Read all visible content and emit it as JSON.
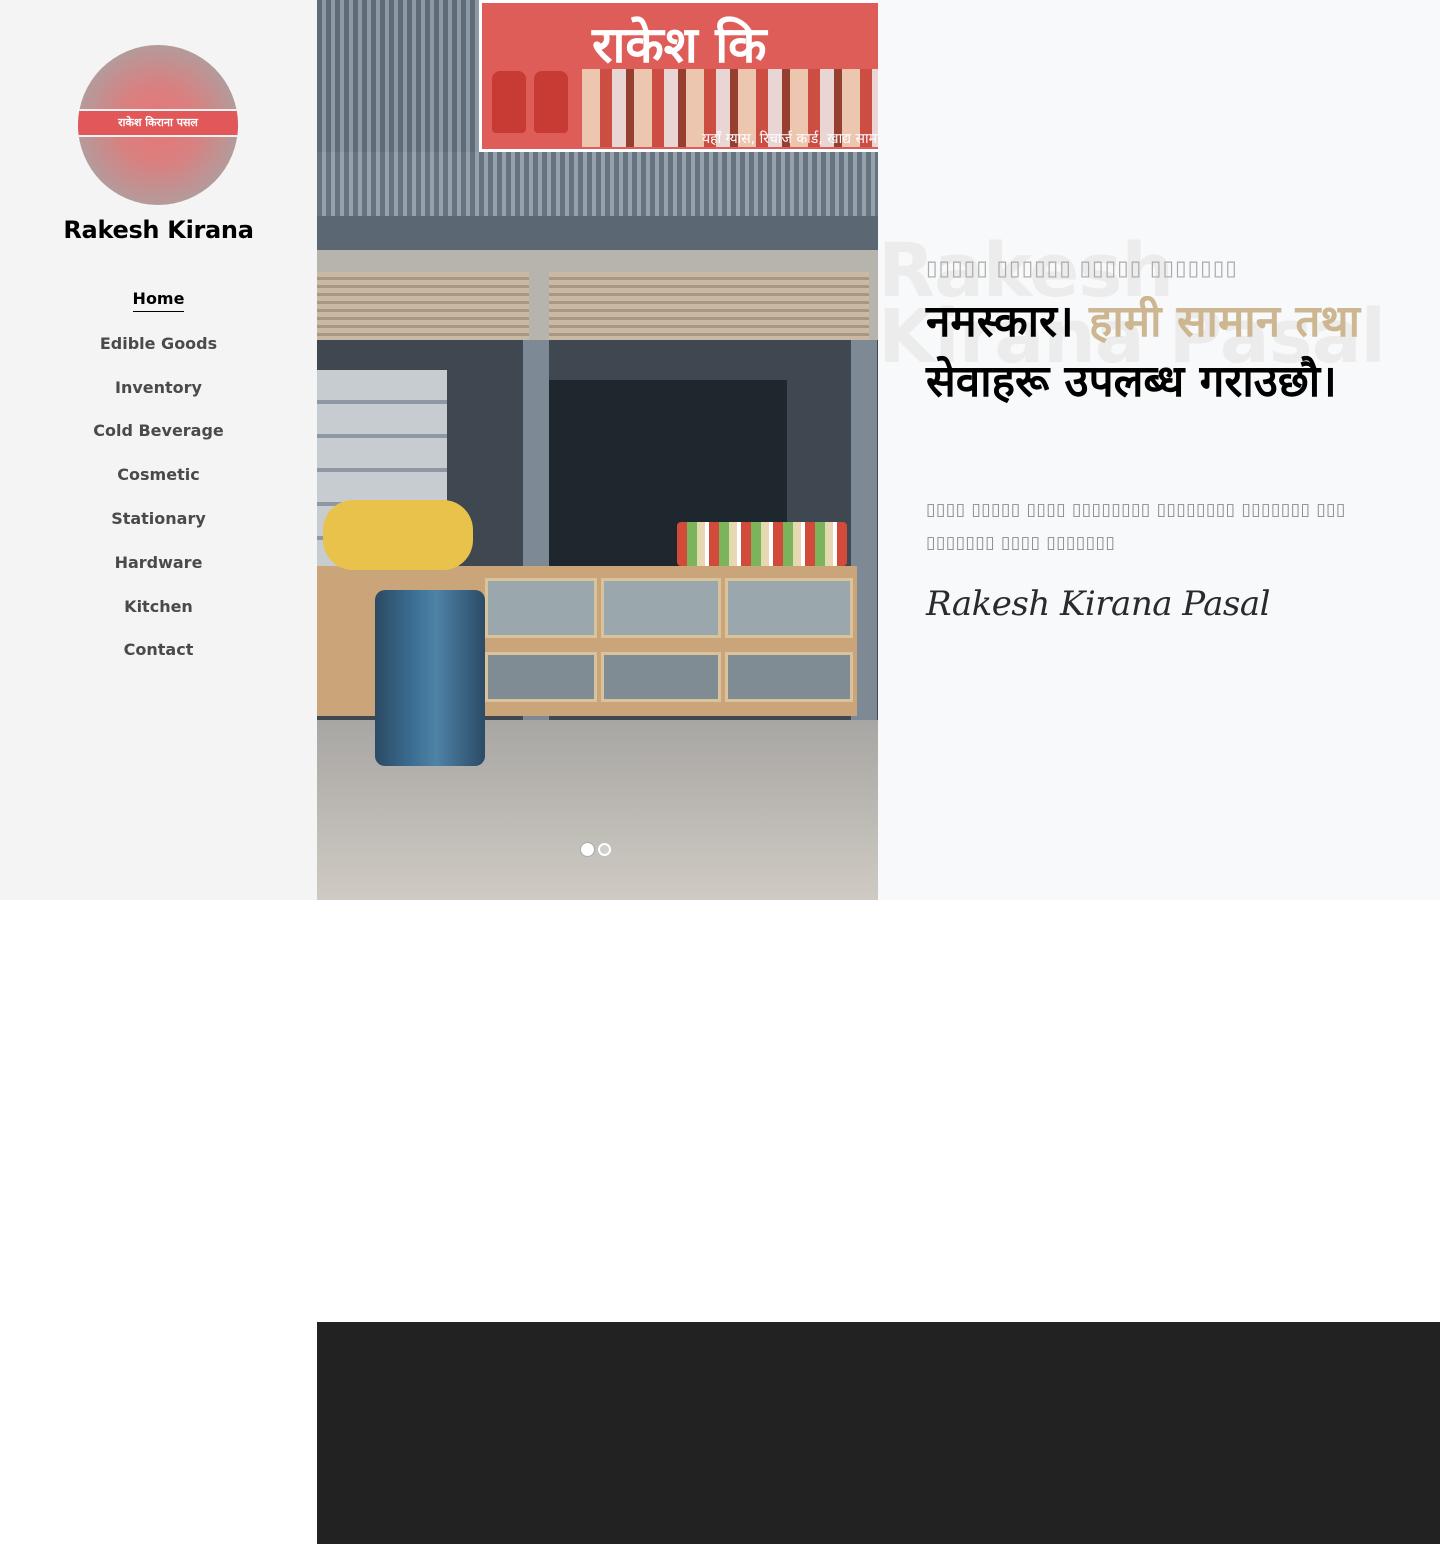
{
  "sidebar": {
    "logo_text": "राकेश किराना पसल",
    "brand": "Rakesh Kirana",
    "nav": [
      {
        "label": "Home",
        "active": true
      },
      {
        "label": "Edible Goods",
        "active": false
      },
      {
        "label": "Inventory",
        "active": false
      },
      {
        "label": "Cold Beverage",
        "active": false
      },
      {
        "label": "Cosmetic",
        "active": false
      },
      {
        "label": "Stationary",
        "active": false
      },
      {
        "label": "Hardware",
        "active": false
      },
      {
        "label": "Kitchen",
        "active": false
      },
      {
        "label": "Contact",
        "active": false
      }
    ]
  },
  "hero": {
    "sign_text": "राकेश कि",
    "sign_sub": "यहाँ ग्यास, रिचार्ज कार्ड, खाद्य सामान, ति",
    "slides_total": 2,
    "active_slide": 1
  },
  "intro": {
    "background_title": "Rakesh Kirana Pasal",
    "subtitle": "▯▯▯▯▯ ▯▯▯▯▯▯ ▯▯▯▯▯ ▯▯▯▯▯▯▯",
    "heading_part1": "नमस्कार। ",
    "heading_accent": "हामी सामान तथा",
    "heading_part2": " सेवाहरू उपलब्ध गराउछौ।",
    "description": "▯▯▯▯ ▯▯▯▯▯ ▯▯▯▯ ▯▯▯▯▯▯▯▯ ▯▯▯▯▯▯▯▯ ▯▯▯▯▯▯▯ ▯▯▯ ▯▯▯▯▯▯▯ ▯▯▯▯ ▯▯▯▯▯▯▯",
    "signature": "Rakesh Kirana Pasal",
    "accent_color": "#cdb792"
  },
  "colors": {
    "sidebar_bg": "#f4f4f4",
    "intro_bg": "#f8f9fa",
    "dark_block": "#222222"
  }
}
